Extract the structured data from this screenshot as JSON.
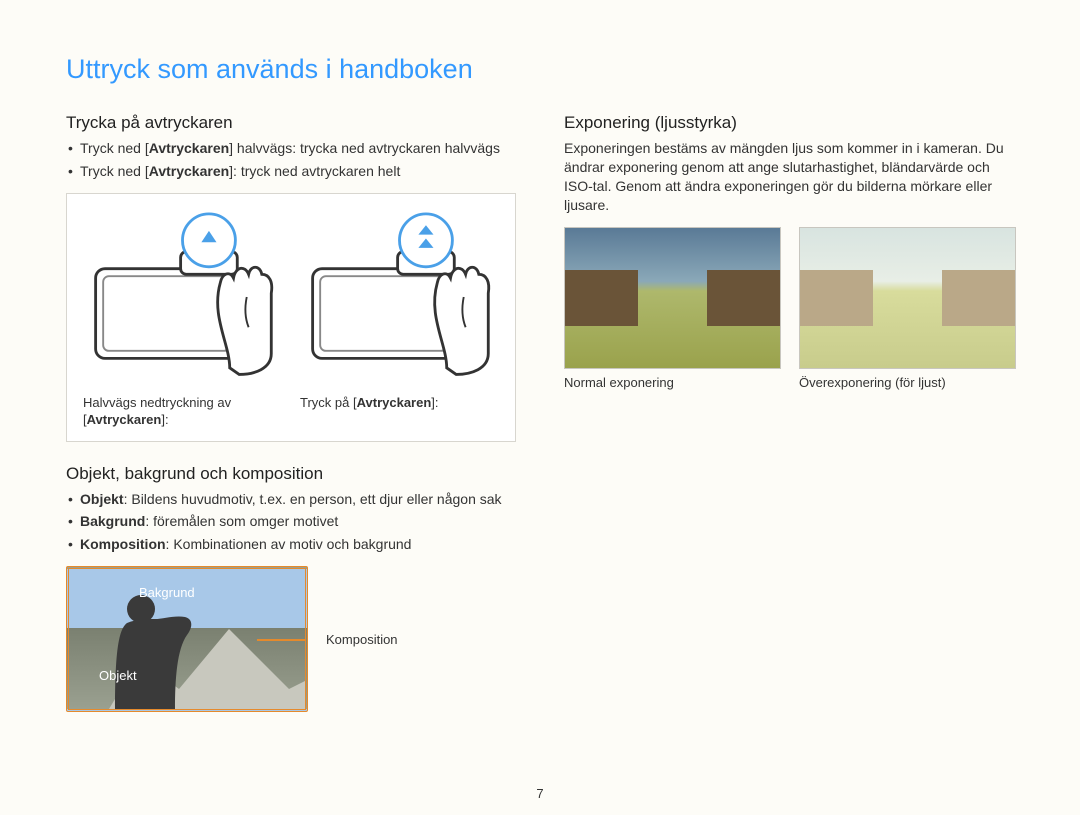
{
  "title": "Uttryck som används i handboken",
  "page_number": "7",
  "left": {
    "shutter": {
      "heading": "Trycka på avtryckaren",
      "bullets": [
        {
          "pre": "Tryck ned ",
          "bracket": "Avtryckaren",
          "post": " halvvägs: trycka ned avtryckaren halvvägs"
        },
        {
          "pre": "Tryck ned ",
          "bracket": "Avtryckaren",
          "post": ": tryck ned avtryckaren helt"
        }
      ],
      "fig": {
        "half_caption_pre": "Halvvägs nedtryckning av ",
        "half_caption_bracket": "Avtryckaren",
        "half_caption_post": ":",
        "full_caption_pre": "Tryck på ",
        "full_caption_bracket": "Avtryckaren",
        "full_caption_post": ":"
      }
    },
    "composition": {
      "heading": "Objekt, bakgrund och komposition",
      "bullets": [
        {
          "bold": "Objekt",
          "text": ": Bildens huvudmotiv, t.ex. en person, ett djur eller någon sak"
        },
        {
          "bold": "Bakgrund",
          "text": ": föremålen som omger motivet"
        },
        {
          "bold": "Komposition",
          "text": ": Kombinationen av motiv och bakgrund"
        }
      ],
      "labels": {
        "bakgrund": "Bakgrund",
        "objekt": "Objekt",
        "komposition": "Komposition"
      }
    }
  },
  "right": {
    "exposure": {
      "heading": "Exponering (ljusstyrka)",
      "body": "Exponeringen bestäms av mängden ljus som kommer in i kameran. Du ändrar exponering genom att ange slutarhastighet, bländarvärde och ISO-tal. Genom att ändra exponeringen gör du bilderna mörkare eller ljusare.",
      "captions": {
        "normal": "Normal exponering",
        "over": "Överexponering (för ljust)"
      }
    }
  }
}
